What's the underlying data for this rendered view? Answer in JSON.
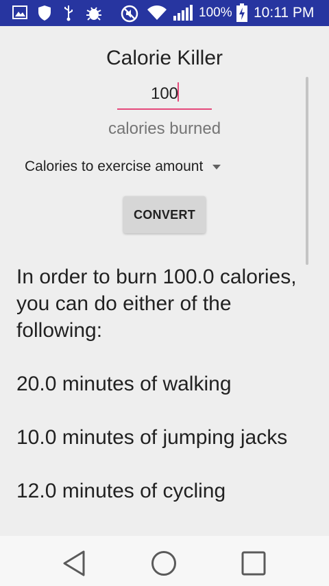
{
  "status_bar": {
    "battery_percent": "100%",
    "time": "10:11 PM",
    "icons": [
      "gallery-icon",
      "shield-icon",
      "usb-icon",
      "bug-icon",
      "mute-icon",
      "wifi-icon",
      "signal-icon",
      "battery-charging-icon"
    ]
  },
  "app": {
    "title": "Calorie Killer"
  },
  "input": {
    "value": "100",
    "label": "calories burned"
  },
  "spinner": {
    "selected": "Calories to exercise amount"
  },
  "convert_button": {
    "label": "CONVERT"
  },
  "results": {
    "intro": "In order to burn 100.0 calories, you can do either of the following:",
    "items": [
      "20.0 minutes of walking",
      "10.0 minutes of jumping jacks",
      "12.0 minutes of cycling"
    ]
  },
  "colors": {
    "status_bar": "#2735a0",
    "accent": "#e5487a",
    "background": "#eeeeee"
  }
}
